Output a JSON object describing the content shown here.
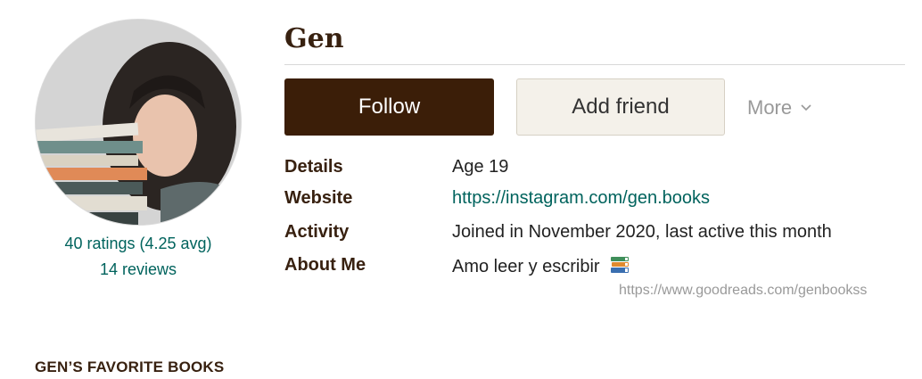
{
  "profile": {
    "name": "Gen",
    "ratings_text": "40 ratings (4.25 avg)",
    "reviews_text": "14 reviews"
  },
  "actions": {
    "follow_label": "Follow",
    "add_friend_label": "Add friend",
    "more_label": "More",
    "more_icon": "chevron-down-icon"
  },
  "details": [
    {
      "label": "Details",
      "value": "Age 19"
    },
    {
      "label": "Website",
      "value": "https://instagram.com/gen.books"
    },
    {
      "label": "Activity",
      "value": "Joined in November 2020, last active this month"
    },
    {
      "label": "About Me",
      "value": "Amo leer y escribir",
      "icon": "books-icon"
    }
  ],
  "watermark": "https://www.goodreads.com/genbookss",
  "favorites_heading": "GEN’S FAVORITE BOOKS",
  "colors": {
    "brand_dark": "#3b1e08",
    "link": "#00635d",
    "button_light": "#f4f1ea",
    "muted": "#999999"
  }
}
